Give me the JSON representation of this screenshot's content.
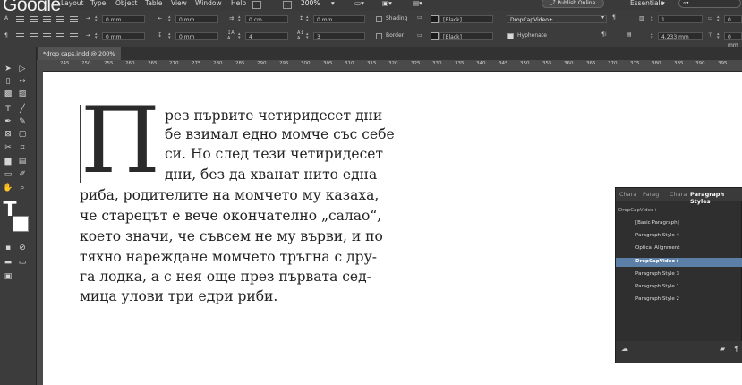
{
  "menu": {
    "logo": "Google",
    "items": [
      "Layout",
      "Type",
      "Object",
      "Table",
      "View",
      "Window",
      "Help"
    ],
    "zoom": "200%",
    "publish": "Publish Online",
    "workspace": "Essentials"
  },
  "control_panel": {
    "fields": [
      "0 mm",
      "0 mm",
      "0 cm",
      "0 mm",
      "0 mm",
      "0 mm",
      "4",
      "3"
    ],
    "shading_label": "Shading",
    "border_label": "Border",
    "swatch_black": "[Black]",
    "paragraph_style": "DropCapVideo+",
    "hyphenate_label": "Hyphenate",
    "right_fields": [
      "1",
      "0",
      "4,233 mm",
      "0 mm"
    ]
  },
  "document_tab": {
    "title": "*drop caps.indd @ 200%"
  },
  "ruler_ticks": [
    "245",
    "250",
    "255",
    "260",
    "265",
    "270",
    "275",
    "280",
    "285",
    "290",
    "295",
    "300",
    "305",
    "310",
    "315",
    "320",
    "325",
    "330",
    "335",
    "340",
    "345",
    "350",
    "355",
    "360",
    "365",
    "370",
    "375",
    "380",
    "385",
    "390",
    "395"
  ],
  "text_frame": {
    "drop_cap": "П",
    "lines": [
      "рез първите четиридесет дни",
      "бе взимал едно момче със себе",
      "си. Но след тези четиридесет",
      "дни, без да хванат нито една",
      "риба, родителите на момчето му казаха,",
      "че старецът е вече окончателно „салао“,",
      "което значи, че съвсем не му върви, и по",
      "тяхно нареждане момчето тръгна с дру-",
      "га лодка, а с нея още през първата сед-",
      "мица улови три едри риби."
    ]
  },
  "paragraph_styles_panel": {
    "tabs": [
      "Chara",
      "Parag",
      "Chara",
      "Paragraph Styles"
    ],
    "current": "DropCapVideo+",
    "items": [
      "[Basic Paragraph]",
      "Paragraph Style 4",
      "Optical Alignment",
      "DropCapVideo+",
      "Paragraph Style 3",
      "Paragraph Style 1",
      "Paragraph Style 2"
    ],
    "selected_index": 3
  },
  "colors": {
    "ui_dark": "#3c3c3c",
    "selection_blue": "#5b7fa6",
    "page": "#ffffff"
  }
}
